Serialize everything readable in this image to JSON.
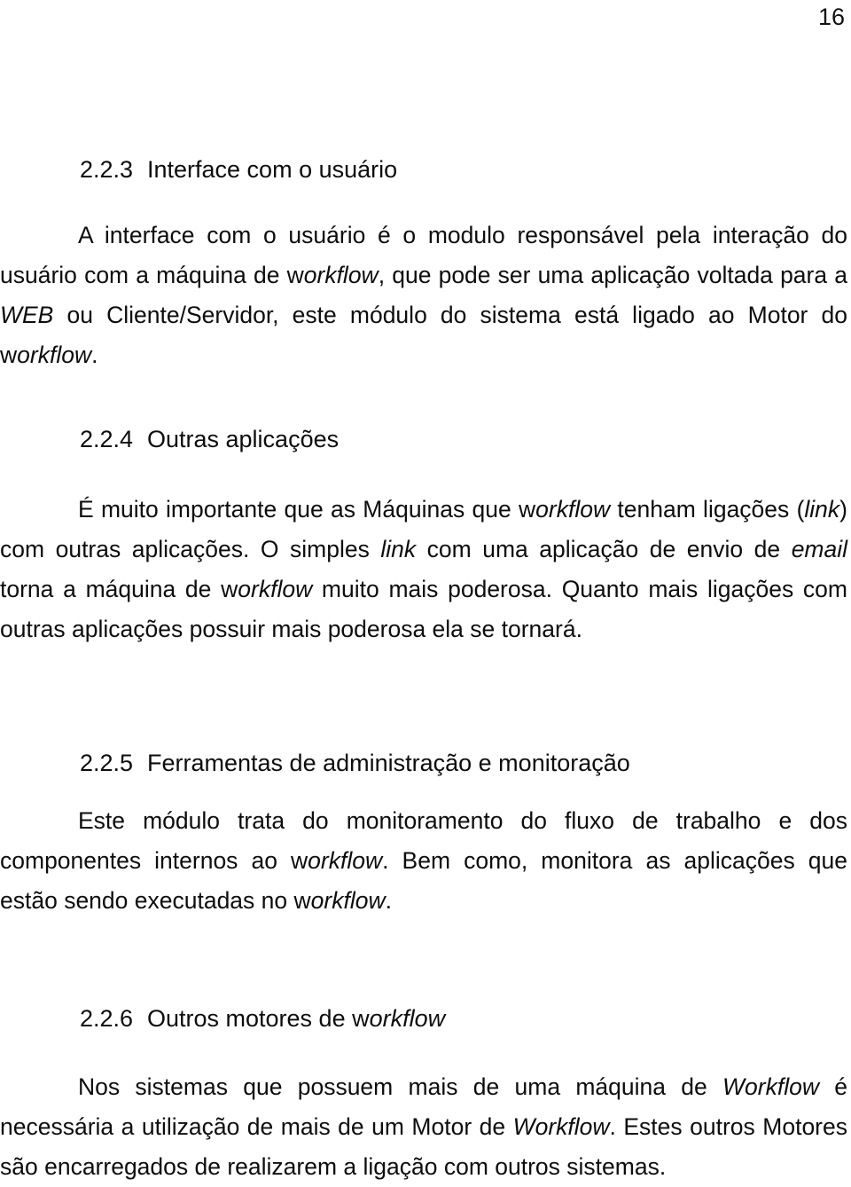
{
  "page": {
    "number": "16"
  },
  "sections": [
    {
      "id": "2.2.3",
      "number": "2.2.3",
      "title": "Interface com o usuário",
      "title_html": "Interface com o usuário",
      "paragraph_html": "A interface com o usuário é o modulo responsável pela interação do usuário com a máquina de w<i>orkflow</i>, que pode ser uma aplicação voltada para a <i>WEB</i> ou Cliente/Servidor, este módulo do sistema está ligado ao Motor do w<i>orkflow</i>.",
      "paragraph_text": "A interface com o usuário é o modulo responsável pela interação do usuário com a máquina de workflow, que pode ser uma aplicação voltada para a WEB ou Cliente/Servidor, este módulo do sistema está ligado ao Motor do workflow."
    },
    {
      "id": "2.2.4",
      "number": "2.2.4",
      "title": "Outras aplicações",
      "title_html": "Outras aplicações",
      "paragraph_html": "É muito importante que as Máquinas que w<i>orkflow</i> tenham ligações (<i>link</i>) com outras aplicações. O simples <i>link</i> com uma aplicação de envio de <i>email</i> torna a máquina de w<i>orkflow</i> muito mais poderosa. Quanto mais ligações com outras aplicações possuir mais poderosa ela se tornará.",
      "paragraph_text": "É muito importante que as Máquinas que workflow tenham ligações (link) com outras aplicações. O simples link com uma aplicação de envio de email torna a máquina de workflow muito mais poderosa. Quanto mais ligações com outras aplicações possuir mais poderosa ela se tornará."
    },
    {
      "id": "2.2.5",
      "number": "2.2.5",
      "title": "Ferramentas de administração e monitoração",
      "title_html": "Ferramentas de administração e monitoração",
      "paragraph_html": "Este módulo trata do monitoramento do fluxo de trabalho e dos componentes internos ao w<i>orkflow</i>. Bem como, monitora as aplicações que estão sendo executadas no w<i>orkflow</i>.",
      "paragraph_text": "Este módulo trata do monitoramento do fluxo de trabalho e dos componentes internos ao workflow. Bem como, monitora as aplicações que estão sendo executadas no workflow."
    },
    {
      "id": "2.2.6",
      "number": "2.2.6",
      "title": "Outros motores de workflow",
      "title_html": "Outros motores de w<i>orkflow</i>",
      "paragraph_html": "Nos sistemas que possuem mais de uma máquina de <i>Workflow</i> é necessária a utilização de mais de um Motor de <i>Workflow</i>. Estes outros Motores são encarregados de realizarem a ligação com outros sistemas.",
      "paragraph_text": "Nos sistemas que possuem mais de uma máquina de Workflow é necessária a utilização de mais de um Motor de Workflow. Estes outros Motores são encarregados de realizarem a ligação com outros sistemas."
    }
  ]
}
